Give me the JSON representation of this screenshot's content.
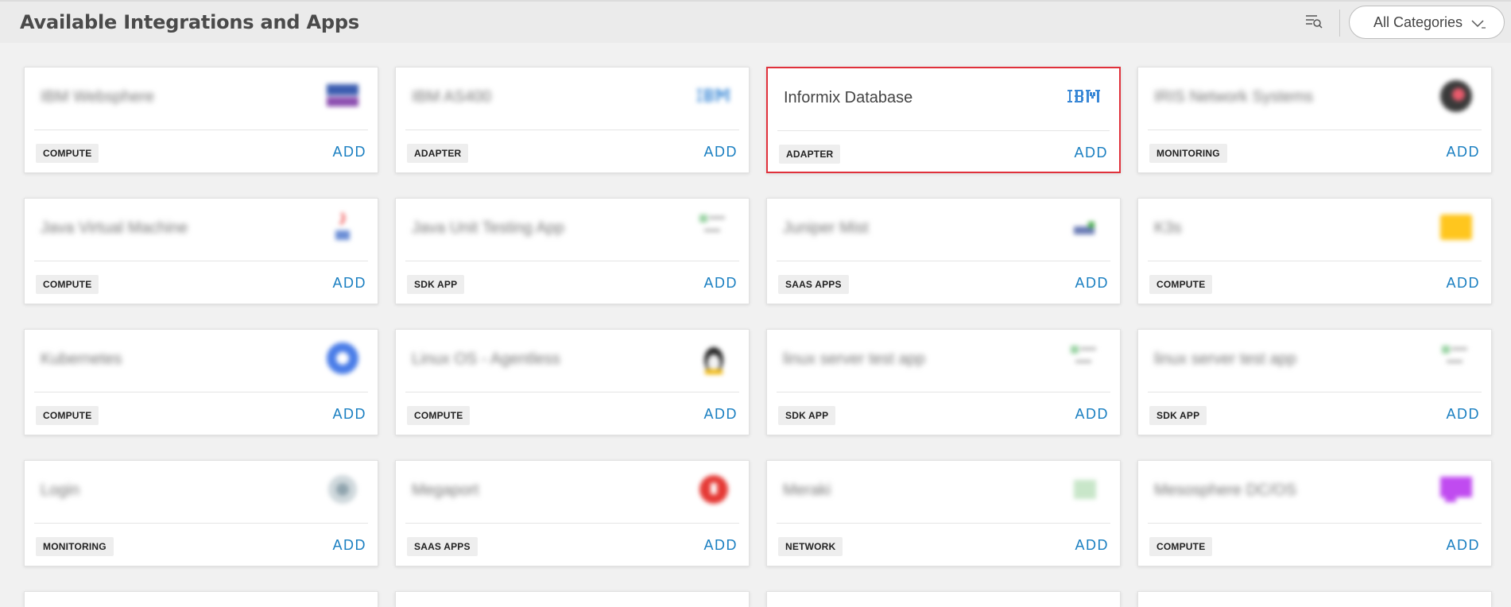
{
  "header": {
    "title": "Available Integrations and Apps",
    "filter_icon": "list-search-icon",
    "category_select": {
      "value": "All Categories"
    }
  },
  "add_label": "ADD",
  "cards": [
    {
      "name": "IBM Websphere",
      "category": "COMPUTE",
      "logo": "websphere-logo",
      "blurred": true
    },
    {
      "name": "IBM AS400",
      "category": "ADAPTER",
      "logo": "ibm-logo",
      "blurred": true
    },
    {
      "name": "Informix Database",
      "category": "ADAPTER",
      "logo": "ibm-logo",
      "blurred": false,
      "selected": true
    },
    {
      "name": "IRIS Network Systems",
      "category": "MONITORING",
      "logo": "iris-logo",
      "blurred": true
    },
    {
      "name": "Java Virtual Machine",
      "category": "COMPUTE",
      "logo": "java-logo",
      "blurred": true
    },
    {
      "name": "Java Unit Testing App",
      "category": "SDK APP",
      "logo": "app-logo",
      "blurred": true
    },
    {
      "name": "Juniper Mist",
      "category": "SAAS APPS",
      "logo": "mist-logo",
      "blurred": true
    },
    {
      "name": "K3s",
      "category": "COMPUTE",
      "logo": "k3s-logo",
      "blurred": true
    },
    {
      "name": "Kubernetes",
      "category": "COMPUTE",
      "logo": "kubernetes-logo",
      "blurred": true
    },
    {
      "name": "Linux OS - Agentless",
      "category": "COMPUTE",
      "logo": "linux-logo",
      "blurred": true
    },
    {
      "name": "linux server test app",
      "category": "SDK APP",
      "logo": "app-logo",
      "blurred": true
    },
    {
      "name": "linux server test app",
      "category": "SDK APP",
      "logo": "app-logo",
      "blurred": true
    },
    {
      "name": "Login",
      "category": "MONITORING",
      "logo": "login-logo",
      "blurred": true
    },
    {
      "name": "Megaport",
      "category": "SAAS APPS",
      "logo": "megaport-logo",
      "blurred": true
    },
    {
      "name": "Meraki",
      "category": "NETWORK",
      "logo": "meraki-logo",
      "blurred": true
    },
    {
      "name": "Mesosphere DC/OS",
      "category": "COMPUTE",
      "logo": "mesosphere-logo",
      "blurred": true
    }
  ],
  "colors": {
    "accent": "#1a7fc1",
    "selected_border": "#e0313b",
    "background": "#f1f1f1"
  }
}
